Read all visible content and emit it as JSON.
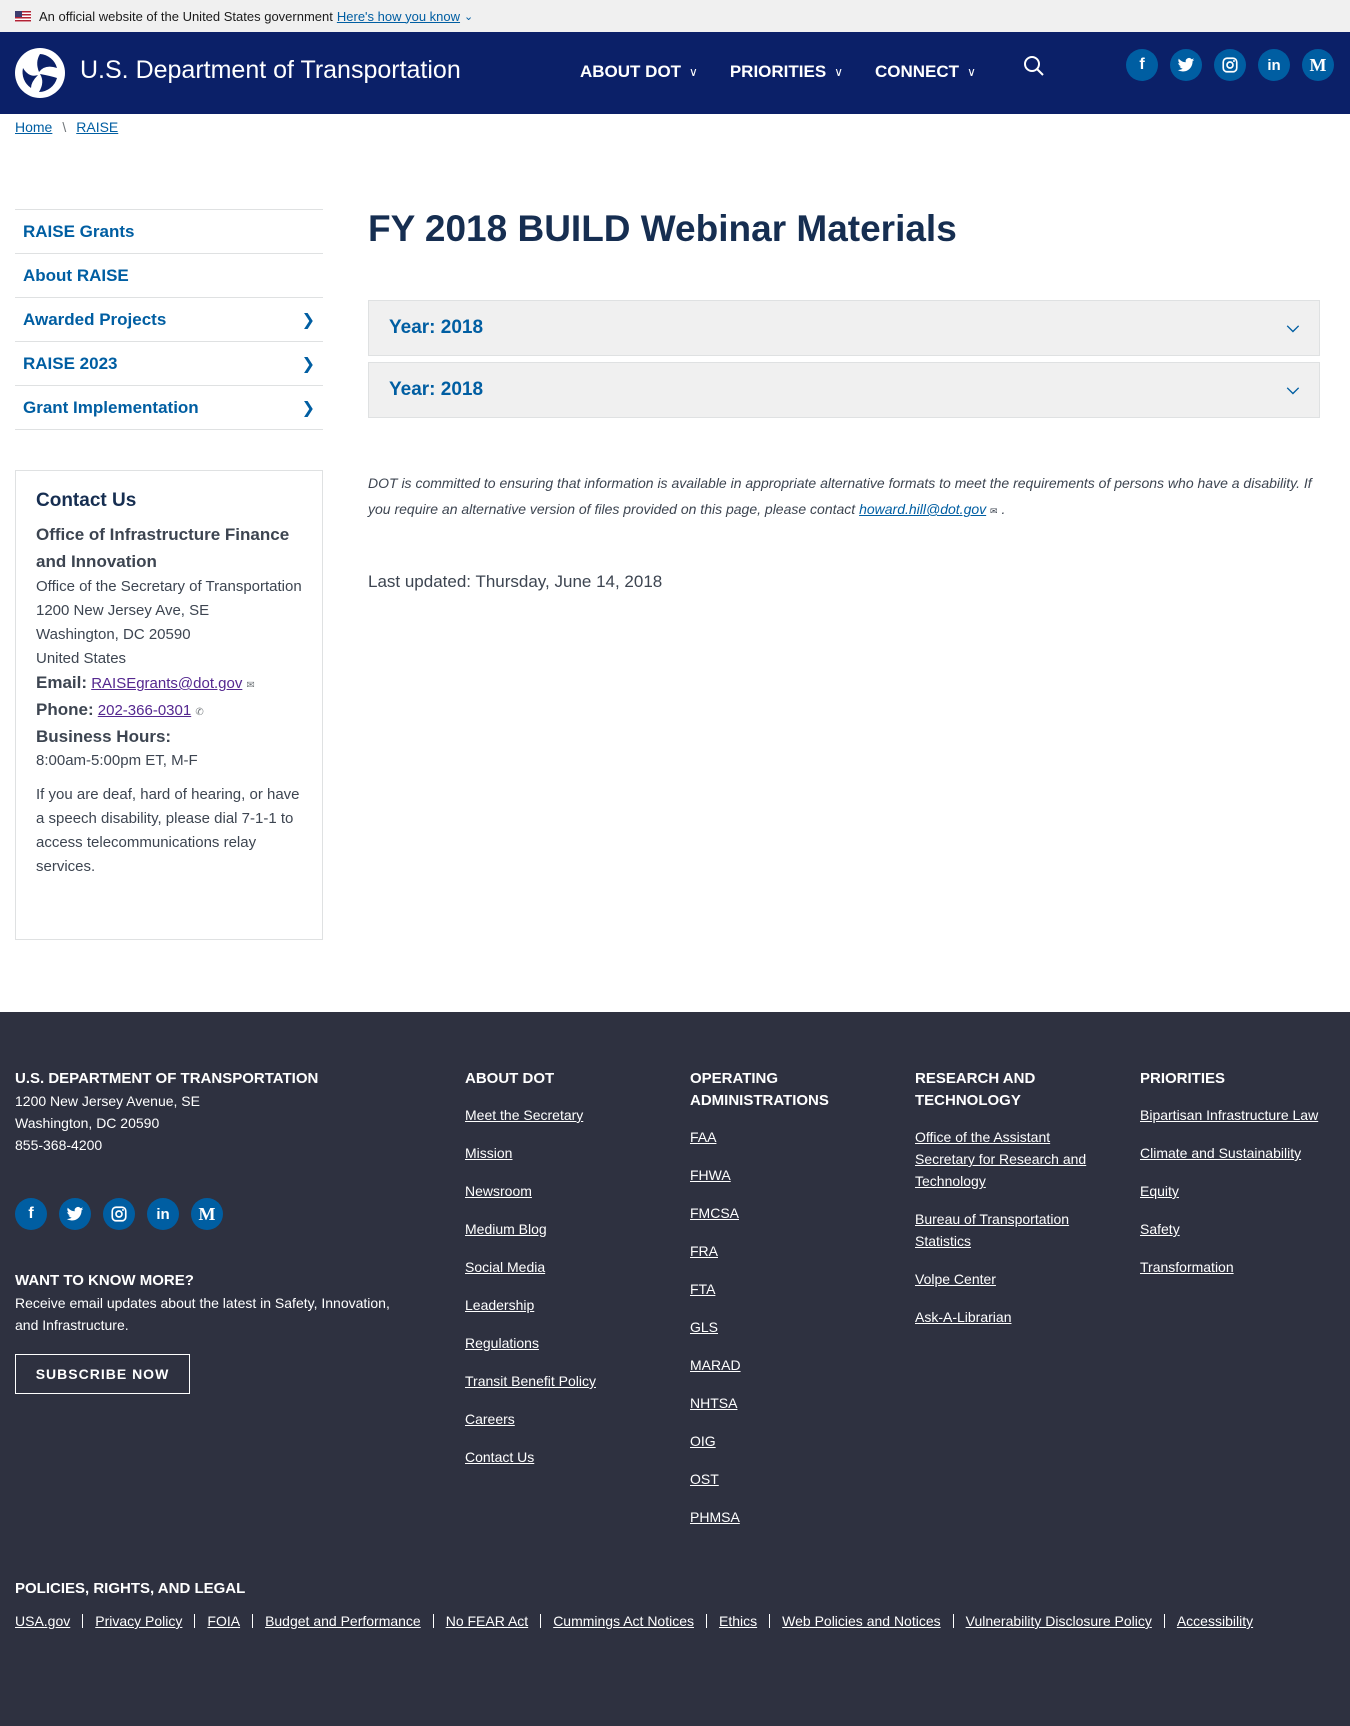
{
  "gov_banner": {
    "text": "An official website of the United States government",
    "howto": "Here's how you know"
  },
  "header": {
    "title": "U.S. Department of Transportation",
    "nav": [
      {
        "label": "ABOUT DOT"
      },
      {
        "label": "PRIORITIES"
      },
      {
        "label": "CONNECT"
      }
    ],
    "social": [
      {
        "icon": "facebook-icon",
        "glyph": "f"
      },
      {
        "icon": "twitter-icon",
        "glyph": "t"
      },
      {
        "icon": "instagram-icon",
        "glyph": "i"
      },
      {
        "icon": "linkedin-icon",
        "glyph": "in"
      },
      {
        "icon": "medium-icon",
        "glyph": "M"
      }
    ]
  },
  "breadcrumb": {
    "home": "Home",
    "sep": "\\",
    "current": "RAISE"
  },
  "side_nav": {
    "items": [
      {
        "label": "RAISE Grants"
      },
      {
        "label": "About RAISE"
      },
      {
        "label": "Awarded Projects"
      },
      {
        "label": "RAISE 2023"
      },
      {
        "label": "Grant Implementation"
      }
    ]
  },
  "contact": {
    "heading": "Contact Us",
    "org": "Office of Infrastructure Finance and Innovation",
    "addr1": "Office of the Secretary of Transportation",
    "addr2": "1200 New Jersey Ave, SE",
    "addr3": "Washington, DC 20590",
    "addr4": "United States",
    "email_label": "Email:",
    "email": "RAISEgrants@dot.gov",
    "phone_label": "Phone:",
    "phone": "202-366-0301",
    "hours_label": "Business Hours:",
    "hours": "8:00am-5:00pm ET, M-F",
    "relay": "If you are deaf, hard of hearing, or have a speech disability, please dial 7-1-1 to access telecommunications relay services."
  },
  "main": {
    "title": "FY 2018 BUILD Webinar Materials",
    "accordions": [
      {
        "label": "Year: 2018"
      },
      {
        "label": "Year: 2018"
      }
    ],
    "notice": "DOT is committed to ensuring that information is available in appropriate alternative formats to meet the requirements of persons who have a disability. If you require an alternative version of files provided on this page, please contact",
    "notice_email": "howard.hill@dot.gov",
    "notice_end": ".",
    "last_updated": "Last updated: Thursday, June 14, 2018"
  },
  "footer": {
    "org": "U.S. DEPARTMENT OF TRANSPORTATION",
    "addr1": "1200 New Jersey Avenue, SE",
    "addr2": "Washington, DC 20590",
    "phone": "855-368-4200",
    "want_head": "WANT TO KNOW MORE?",
    "want_text": "Receive email updates about the latest in Safety, Innovation, and Infrastructure.",
    "subscribe": "SUBSCRIBE NOW",
    "about": {
      "head": "ABOUT DOT",
      "links": [
        "Meet the Secretary",
        "Mission",
        "Newsroom",
        "Medium Blog",
        "Social Media",
        "Leadership",
        "Regulations",
        "Transit Benefit Policy",
        "Careers",
        "Contact Us"
      ]
    },
    "opadmin": {
      "head": "OPERATING ADMINISTRATIONS",
      "links": [
        "FAA",
        "FHWA",
        "FMCSA",
        "FRA",
        "FTA",
        "GLS",
        "MARAD",
        "NHTSA",
        "OIG",
        "OST",
        "PHMSA"
      ]
    },
    "research": {
      "head": "RESEARCH AND TECHNOLOGY",
      "links": [
        "Office of the Assistant Secretary for Research and Technology",
        "Bureau of Transportation Statistics",
        "Volpe Center",
        "Ask-A-Librarian"
      ]
    },
    "priorities": {
      "head": "PRIORITIES",
      "links": [
        "Bipartisan Infrastructure Law",
        "Climate and Sustainability",
        "Equity",
        "Safety",
        "Transformation"
      ]
    },
    "legal_head": "POLICIES, RIGHTS, AND LEGAL",
    "legal_links": [
      "USA.gov",
      "Privacy Policy",
      "FOIA",
      "Budget and Performance",
      "No FEAR Act",
      "Cummings Act Notices",
      "Ethics",
      "Web Policies and Notices",
      "Vulnerability Disclosure Policy",
      "Accessibility"
    ]
  }
}
